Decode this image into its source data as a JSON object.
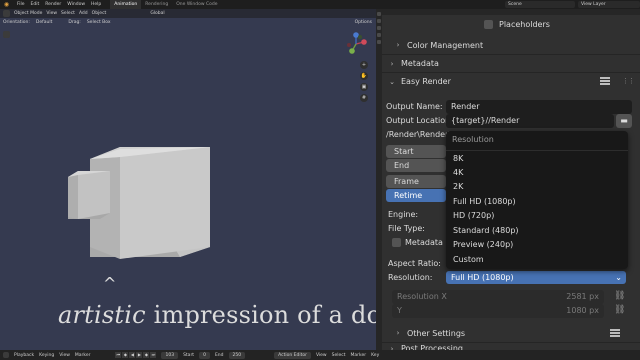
{
  "topbar": {
    "menu": [
      "File",
      "Edit",
      "Render",
      "Window",
      "Help"
    ],
    "workspaces": [
      {
        "label": "Animation",
        "active": true
      },
      {
        "label": "Rendering",
        "active": false
      },
      {
        "label": "One Window Code",
        "active": false
      }
    ],
    "scene": "Scene",
    "view_layer": "View Layer"
  },
  "viewport": {
    "mode": "Object Mode",
    "header_items": [
      "View",
      "Select",
      "Add",
      "Object"
    ],
    "orientation_label": "Orientation:",
    "orientation_value": "Default",
    "drag_label": "Drag:",
    "drag_value": "Select Box",
    "transform_space": "Global",
    "options_label": "Options",
    "caption_italic": "artistic",
    "caption_rest": " impression of a dog",
    "caret": "^"
  },
  "timeline": {
    "playback": "Playback",
    "keying": "Keying",
    "view": "View",
    "marker": "Marker",
    "current_frame": "103",
    "start_label": "Start",
    "start_value": "0",
    "end_label": "End",
    "end_value": "250",
    "right_items": [
      "View",
      "Select",
      "Marker",
      "Key"
    ],
    "action_editor": "Action Editor"
  },
  "properties": {
    "placeholders": "Placeholders",
    "color_management": "Color Management",
    "metadata": "Metadata",
    "easy_render": "Easy Render",
    "output_name_label": "Output Name:",
    "output_name_value": "Render",
    "output_location_label": "Output Location:",
    "output_location_value": "{target}//Render",
    "output_path": "/Render\\Render\\R",
    "start_frame": "Start Frame",
    "end": "End",
    "frame_rate": "Frame Rate",
    "retime": "Retime",
    "engine_label": "Engine:",
    "file_type_label": "File Type:",
    "metadata_checkbox": "Metadata",
    "aspect_ratio_label": "Aspect Ratio:",
    "resolution_label": "Resolution:",
    "resolution_value": "Full HD (1080p)",
    "resolution_x_label": "Resolution X",
    "resolution_x_value": "2581 px",
    "y_label": "Y",
    "y_value": "1080 px",
    "other_settings": "Other Settings",
    "post_processing": "Post Processing"
  },
  "dropdown": {
    "title": "Resolution",
    "options": [
      "8K",
      "4K",
      "2K",
      "Full HD (1080p)",
      "HD (720p)",
      "Standard (480p)",
      "Preview (240p)",
      "Custom"
    ]
  },
  "colors": {
    "accent": "#4772b3",
    "viewport_bg": "#353a50",
    "panel_bg": "#303030"
  }
}
